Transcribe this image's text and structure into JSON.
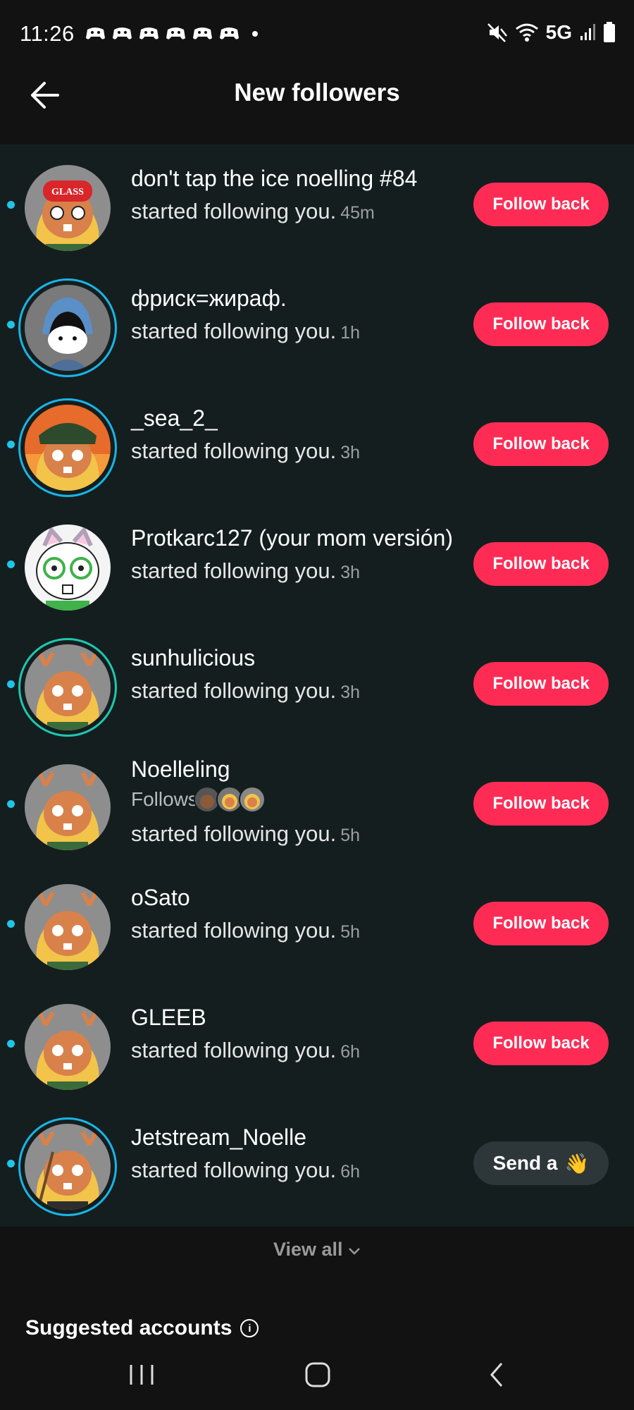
{
  "status_bar": {
    "time": "11:26",
    "network": "5G"
  },
  "header": {
    "title": "New followers"
  },
  "followers": [
    {
      "name": "don't tap the ice noelling #84",
      "action": "started following you.",
      "time": "45m",
      "button": "Follow back",
      "ring": false,
      "hat": "GLASS"
    },
    {
      "name": "фриск=жираф.",
      "action": "started following you.",
      "time": "1h",
      "button": "Follow back",
      "ring": true
    },
    {
      "name": "_sea_2_",
      "action": "started following you.",
      "time": "3h",
      "button": "Follow back",
      "ring": true
    },
    {
      "name": "Protkarc127 (your mom versión)",
      "action": "started following you.",
      "time": "3h",
      "button": "Follow back",
      "ring": false
    },
    {
      "name": "sunhulicious",
      "action": "started following you.",
      "time": "3h",
      "button": "Follow back",
      "ring": true
    },
    {
      "name": "Noelleling",
      "follows_label": "Follows",
      "action": "started following you.",
      "time": "5h",
      "button": "Follow back",
      "ring": false
    },
    {
      "name": "oSato",
      "action": "started following you.",
      "time": "5h",
      "button": "Follow back",
      "ring": false
    },
    {
      "name": "GLEEB",
      "action": "started following you.",
      "time": "6h",
      "button": "Follow back",
      "ring": false
    },
    {
      "name": "Jetstream_Noelle",
      "action": "started following you.",
      "time": "6h",
      "button": "Send a",
      "button_emoji": "👋",
      "ring": true
    }
  ],
  "view_all": "View all",
  "suggested": {
    "title": "Suggested accounts"
  },
  "colors": {
    "follow_button": "#fe2c55",
    "unread_dot": "#20c4e8",
    "story_ring": "#19b5e6"
  }
}
